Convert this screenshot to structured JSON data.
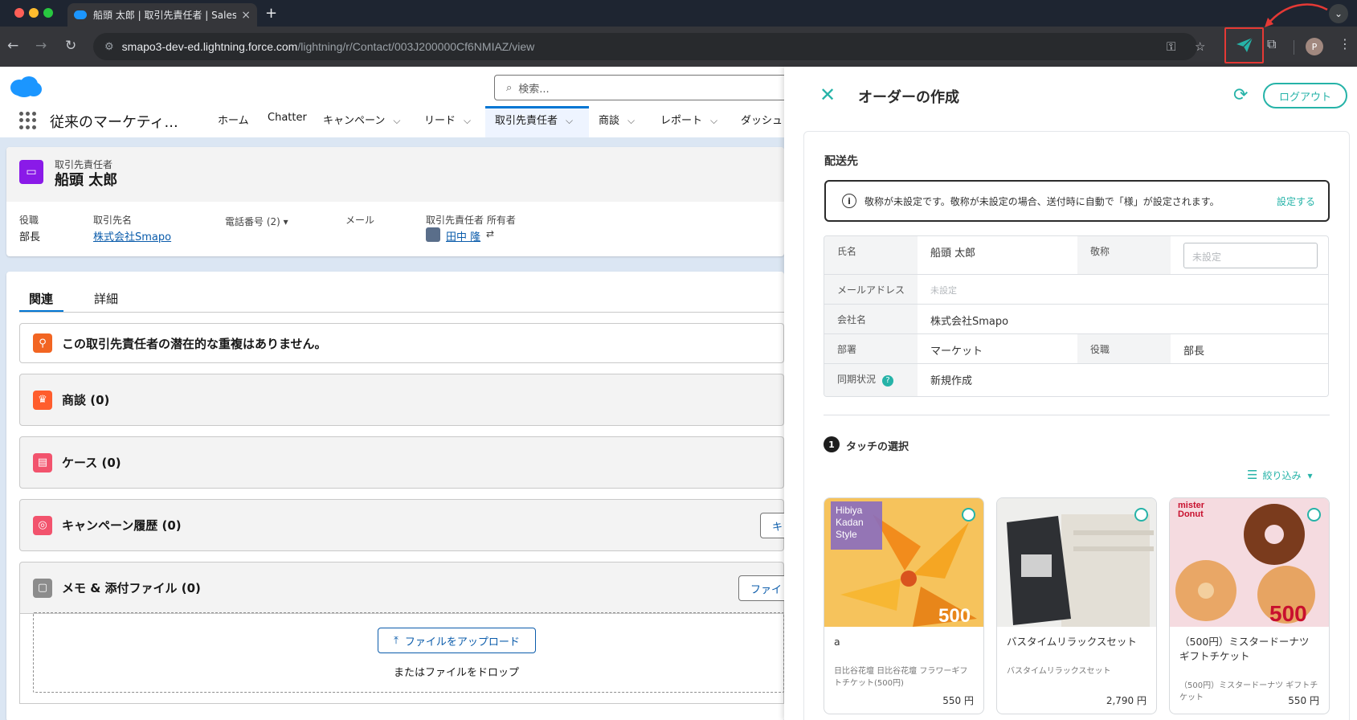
{
  "browser": {
    "tab_title": "船頭 太郎 | 取引先責任者 | Salesf",
    "url_host": "smapo3-dev-ed.lightning.force.com",
    "url_path": "/lightning/r/Contact/003J200000Cf6NMIAZ/view",
    "profile_initial": "P"
  },
  "sf": {
    "search_placeholder": "検索...",
    "app_name": "従来のマーケティ...",
    "nav": {
      "home": "ホーム",
      "chatter": "Chatter",
      "campaign": "キャンペーン",
      "lead": "リード",
      "contact": "取引先責任者",
      "opportunity": "商談",
      "report": "レポート",
      "dashboard": "ダッシュ"
    },
    "record": {
      "object_label": "取引先責任者",
      "name": "船頭 太郎",
      "title_label": "役職",
      "title_value": "部長",
      "account_label": "取引先名",
      "account_value": "株式会社Smapo",
      "phone_label": "電話番号 (2)",
      "email_label": "メール",
      "owner_label": "取引先責任者 所有者",
      "owner_value": "田中 隆"
    },
    "tabs": {
      "related": "関連",
      "detail": "詳細"
    },
    "related": {
      "duplicate": "この取引先責任者の潜在的な重複はありません。",
      "opportunity": "商談 (0)",
      "case": "ケース (0)",
      "campaign_history": "キャンペーン履歴 (0)",
      "campaign_btn": "キ",
      "notes": "メモ & 添付ファイル (0)",
      "file_btn": "ファイ",
      "upload": "ファイルをアップロード",
      "drop": "またはファイルをドロップ"
    }
  },
  "panel": {
    "title": "オーダーの作成",
    "logout": "ログアウト",
    "shipping_title": "配送先",
    "notice": "敬称が未設定です。敬称が未設定の場合、送付時に自動で「様」が設定されます。",
    "notice_link": "設定する",
    "fields": {
      "name_label": "氏名",
      "name_value": "船頭 太郎",
      "honorific_label": "敬称",
      "honorific_placeholder": "未設定",
      "email_label": "メールアドレス",
      "email_value": "未設定",
      "company_label": "会社名",
      "company_value": "株式会社Smapo",
      "dept_label": "部署",
      "dept_value": "マーケット",
      "role_label": "役職",
      "role_value": "部長",
      "sync_label": "同期状況",
      "sync_value": "新規作成"
    },
    "step_number": "1",
    "step_title": "タッチの選択",
    "filter": "絞り込み",
    "products": [
      {
        "name": "a",
        "desc": "日比谷花壇 日比谷花壇 フラワーギフトチケット(500円)",
        "price": "550 円",
        "img_text": "Hibiya Kadan Style",
        "img_sub": "500"
      },
      {
        "name": "バスタイムリラックスセット",
        "desc": "バスタイムリラックスセット",
        "price": "2,790 円",
        "img_text": "",
        "img_sub": ""
      },
      {
        "name": "（500円）ミスタードーナツ ギフトチケット",
        "desc": "（500円）ミスタードーナツ ギフトチケット",
        "price": "550 円",
        "img_text": "mister Donut",
        "img_sub": "500"
      }
    ]
  },
  "colors": {
    "accent": "#26b3a8",
    "sf_blue": "#0176d3",
    "highlight_box": "#e53935"
  }
}
